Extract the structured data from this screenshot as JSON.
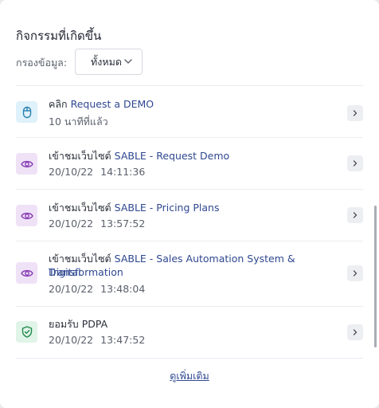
{
  "panel": {
    "title": "กิจกรรมที่เกิดขึ้น",
    "filter_label": "กรองข้อมูล:",
    "filter_value": "ทั้งหมด",
    "more_link": "ดูเพิ่มเติม"
  },
  "activities": [
    {
      "icon": "mouse-icon",
      "prefix": "คลิก",
      "link": "Request a DEMO",
      "link2": "",
      "time": "10 นาทีที่แล้ว",
      "date": "",
      "clock": ""
    },
    {
      "icon": "eye-icon",
      "prefix": "เข้าชมเว็บไซต์",
      "link": "SABLE - Request Demo",
      "link2": "",
      "time": "",
      "date": "20/10/22",
      "clock": "14:11:36"
    },
    {
      "icon": "eye-icon",
      "prefix": "เข้าชมเว็บไซต์",
      "link": "SABLE - Pricing Plans",
      "link2": "",
      "time": "",
      "date": "20/10/22",
      "clock": "13:57:52"
    },
    {
      "icon": "eye-icon",
      "prefix": "เข้าชมเว็บไซต์",
      "link": "SABLE - Sales Automation System & Digital",
      "link2": "Transformation",
      "time": "",
      "date": "20/10/22",
      "clock": "13:48:04"
    },
    {
      "icon": "shield-check-icon",
      "prefix": "ยอมรับ PDPA",
      "link": "",
      "link2": "",
      "time": "",
      "date": "20/10/22",
      "clock": "13:47:52"
    }
  ],
  "colors": {
    "link": "#2f4890",
    "mouse_bg": "#dff1fa",
    "eye_bg": "#efe2f7",
    "shield_bg": "#e1f4e8",
    "mouse_fg": "#2a7fb0",
    "eye_fg": "#8a3fb5",
    "shield_fg": "#1f8a4c"
  }
}
